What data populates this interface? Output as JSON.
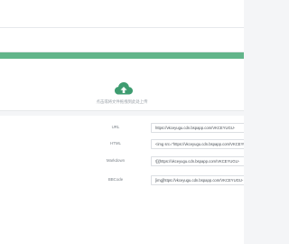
{
  "colors": {
    "accent": "#62b58a",
    "icon": "#3e9c70",
    "background": "#f4f5f7"
  },
  "upload": {
    "icon": "cloud-upload-icon",
    "hint": "点击或将文件拖拽到此处上传"
  },
  "links": [
    {
      "label": "URL",
      "value": "https://vkceyugu.cdn.bspapp.com/VKCEYUGU-"
    },
    {
      "label": "HTML",
      "value": "<img src=\"https://vkceyugu.cdn.bspapp.com/VKCEYUGU-"
    },
    {
      "label": "Markdown",
      "value": "![](https://vkceyugu.cdn.bspapp.com/VKCEYUGU-"
    },
    {
      "label": "BBCode",
      "value": "[img]https://vkceyugu.cdn.bspapp.com/VKCEYUGU-"
    }
  ]
}
